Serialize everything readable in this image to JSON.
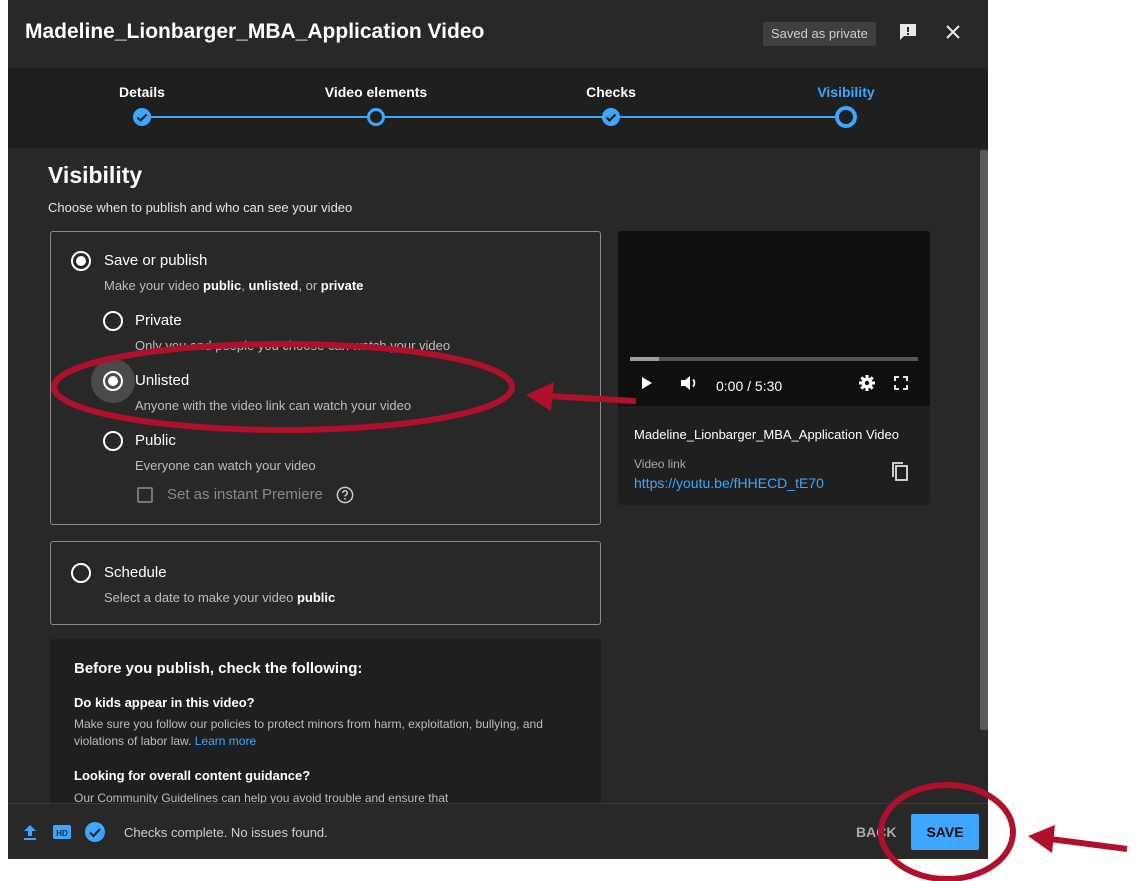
{
  "window": {
    "title": "Madeline_Lionbarger_MBA_Application Video",
    "saved_badge": "Saved as private"
  },
  "stepper": {
    "steps": [
      {
        "label": "Details",
        "state": "complete"
      },
      {
        "label": "Video elements",
        "state": "visited"
      },
      {
        "label": "Checks",
        "state": "complete"
      },
      {
        "label": "Visibility",
        "state": "current"
      }
    ]
  },
  "visibility": {
    "title": "Visibility",
    "subtitle": "Choose when to publish and who can see your video",
    "save_or_publish": {
      "label": "Save or publish",
      "desc_prefix": "Make your video ",
      "desc_public": "public",
      "desc_sep1": ", ",
      "desc_unlisted": "unlisted",
      "desc_sep2": ", or ",
      "desc_private": "private",
      "selected": true
    },
    "options": [
      {
        "label": "Private",
        "desc": "Only you and people you choose can watch your video",
        "selected": false
      },
      {
        "label": "Unlisted",
        "desc": "Anyone with the video link can watch your video",
        "selected": true
      },
      {
        "label": "Public",
        "desc": "Everyone can watch your video",
        "selected": false
      }
    ],
    "premiere_label": "Set as instant Premiere",
    "schedule": {
      "label": "Schedule",
      "desc_prefix": "Select a date to make your video ",
      "desc_bold": "public"
    }
  },
  "preview": {
    "time": "0:00 / 5:30",
    "progress_fraction": 0.1,
    "video_title": "Madeline_Lionbarger_MBA_Application Video",
    "link_label": "Video link",
    "link": "https://youtu.be/fHHECD_tE70"
  },
  "checklist": {
    "title": "Before you publish, check the following:",
    "q1": "Do kids appear in this video?",
    "p1": "Make sure you follow our policies to protect minors from harm, exploitation, bullying, and violations of labor law.",
    "p1_link": "Learn more",
    "q2": "Looking for overall content guidance?",
    "p2": "Our Community Guidelines can help you avoid trouble and ensure that"
  },
  "footer": {
    "status": "Checks complete. No issues found.",
    "back": "BACK",
    "save": "SAVE"
  },
  "colors": {
    "accent": "#3ea6ff",
    "annotation": "#b0102b",
    "dialog_bg": "#282828"
  }
}
